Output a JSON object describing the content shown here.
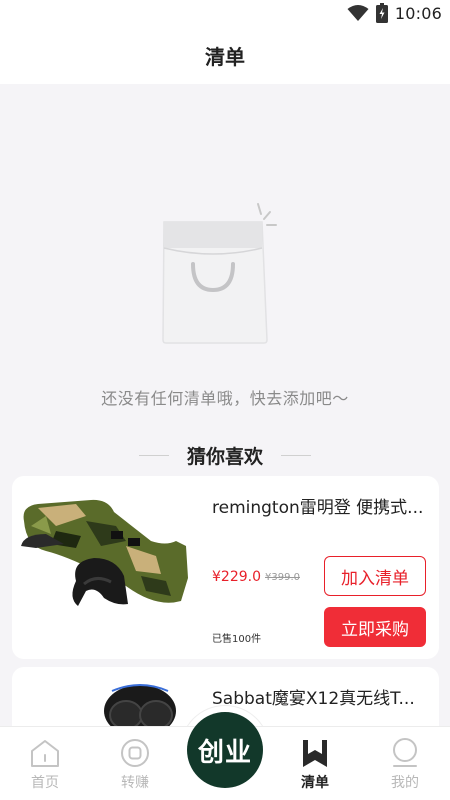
{
  "status_bar": {
    "time": "10:06"
  },
  "header": {
    "title": "清单"
  },
  "empty_state": {
    "message": "还没有任何清单哦，快去添加吧～"
  },
  "recommend": {
    "title": "猜你喜欢",
    "products": [
      {
        "name": "remington雷明登 便携式...",
        "price": "¥229.0",
        "old_price": "¥399.0",
        "sold": "已售100件",
        "add_label": "加入清单",
        "buy_label": "立即采购"
      },
      {
        "name": "Sabbat魔宴X12真无线T..."
      }
    ]
  },
  "tabbar": {
    "tabs": [
      {
        "label": "首页",
        "icon": "home-icon"
      },
      {
        "label": "转赚",
        "icon": "target-icon"
      },
      {
        "label": "创业",
        "icon": "startup-button"
      },
      {
        "label": "清单",
        "icon": "bookmark-icon",
        "active": true
      },
      {
        "label": "我的",
        "icon": "person-icon"
      }
    ]
  },
  "colors": {
    "accent_red": "#f02d37",
    "center_button": "#12382a"
  }
}
